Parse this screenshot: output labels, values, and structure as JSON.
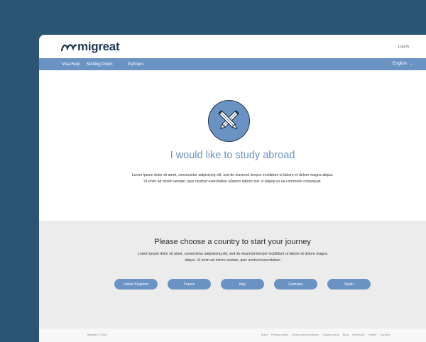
{
  "header": {
    "logo_text": "migreat",
    "login_label": "Log In"
  },
  "nav": {
    "items": [
      {
        "label": "Visa Help"
      },
      {
        "label": "Settling Down"
      },
      {
        "label": "Partners"
      }
    ],
    "language": "English"
  },
  "hero": {
    "icon": "pencils-crossed-icon",
    "title": "I would like to study abroad",
    "text": "Lorem ipsum dolor sit amet, consectetur adipisicing elit, sed do eiusmod tempor incididunt ut labore et dolore magna aliqua. Ut enim ad minim veniam, quis nostrud exercitation ullamco laboris nisi ut aliquip ex ea commodo consequat."
  },
  "choose": {
    "title": "Please choose a country to start your journey",
    "text": "Lorem ipsum dolor sit amet, consectetur adipisicing elit, sed do eiusmod tempor incididunt ut labore et dolore magna aliqua. Ut enim ad minim veniam, quis nostrud exercitation",
    "countries": [
      {
        "label": "United Kingdom"
      },
      {
        "label": "France"
      },
      {
        "label": "Italy"
      },
      {
        "label": "Germany"
      },
      {
        "label": "Spain"
      }
    ]
  },
  "footer": {
    "copyright": "Migreat © 2015",
    "links": [
      {
        "label": "Team"
      },
      {
        "label": "Privacy policy"
      },
      {
        "label": "Terms and conditions"
      },
      {
        "label": "Cookie policy"
      },
      {
        "label": "Blog"
      },
      {
        "label": "Facebook"
      },
      {
        "label": "Twitter"
      },
      {
        "label": "Contact"
      }
    ]
  },
  "colors": {
    "background": "#2a5674",
    "accent": "#6a93c4",
    "brand_dark": "#1f3a56",
    "section_gray": "#ececec"
  }
}
